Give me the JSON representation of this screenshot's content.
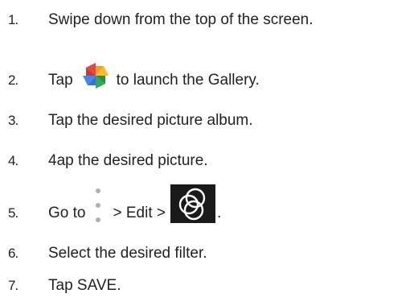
{
  "steps": [
    {
      "num": "1.",
      "text": "Swipe down from the top of the screen."
    },
    {
      "num": "2.",
      "before": "Tap",
      "icon": "photos-pinwheel-icon",
      "after": "to launch the Gallery."
    },
    {
      "num": "3.",
      "text": "Tap the desired picture album."
    },
    {
      "num": "4.",
      "text": "4ap the desired picture."
    },
    {
      "num": "5.",
      "before": "Go to",
      "icon1": "more-options-icon",
      "middle": "> Edit >",
      "icon2": "filter-icon",
      "after": "."
    },
    {
      "num": "6.",
      "text": "Select the desired filter."
    },
    {
      "num": "7.",
      "text": "Tap SAVE."
    }
  ],
  "colors": {
    "text": "#222222",
    "pinwheel_red": "#e8453c",
    "pinwheel_yellow": "#f9bb2d",
    "pinwheel_green": "#34a853",
    "pinwheel_blue": "#4285f4",
    "dots": "#b0b0b0",
    "filter_bg": "#1a1a1a",
    "filter_stroke": "#ffffff"
  }
}
